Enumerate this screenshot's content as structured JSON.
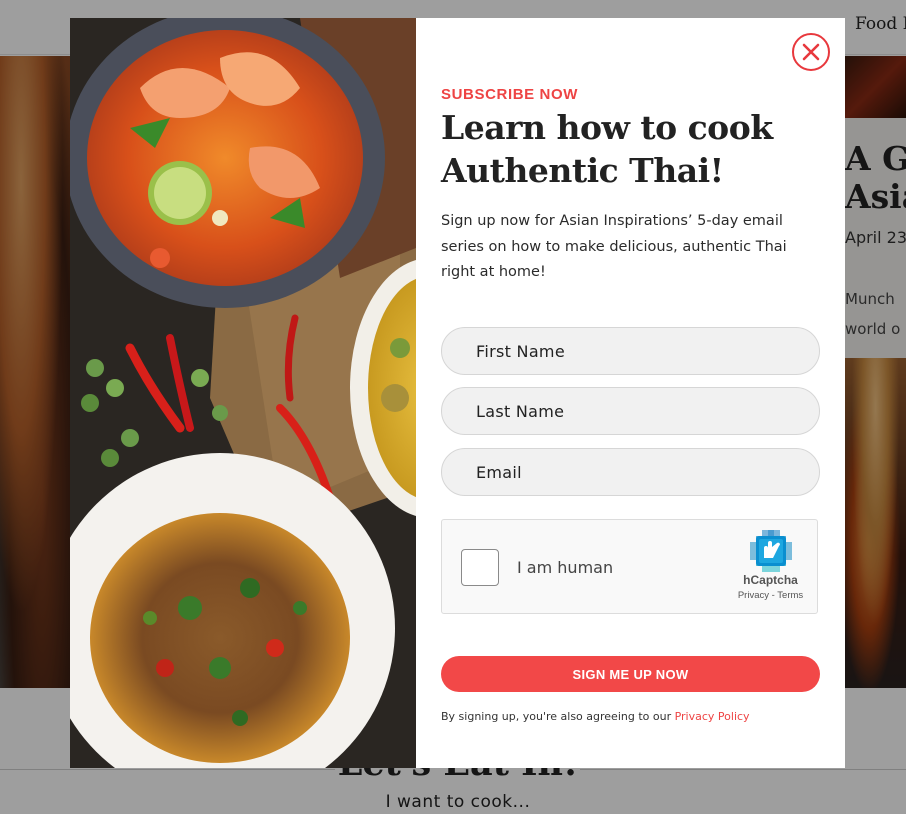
{
  "background": {
    "nav": {
      "item_right": "Food K"
    },
    "card": {
      "title_line1": "A Gu",
      "title_line2": "Asia",
      "date": "April 23",
      "text_line1": "Munch",
      "text_line2": "world o"
    },
    "section": {
      "heading": "Let's Eat In!",
      "subheading": "I want to cook..."
    }
  },
  "modal": {
    "close_icon": "close-x-circle-icon",
    "eyebrow": "SUBSCRIBE NOW",
    "headline_line1": "Learn how to cook",
    "headline_line2": "Authentic Thai!",
    "description": "Sign up now for Asian Inspirations’ 5-day email series on how to make delicious, authentic Thai right at home!",
    "fields": {
      "first_name_placeholder": "First Name",
      "last_name_placeholder": "Last Name",
      "email_placeholder": "Email"
    },
    "captcha": {
      "label": "I am human",
      "brand": "hCaptcha",
      "privacy": "Privacy",
      "separator": " - ",
      "terms": "Terms"
    },
    "submit_label": "SIGN ME UP NOW",
    "legal_text": "By signing up, you're also agreeing to our ",
    "legal_link": "Privacy Policy"
  },
  "colors": {
    "accent": "#f24848",
    "overlay": "rgba(0,0,0,0.38)"
  }
}
